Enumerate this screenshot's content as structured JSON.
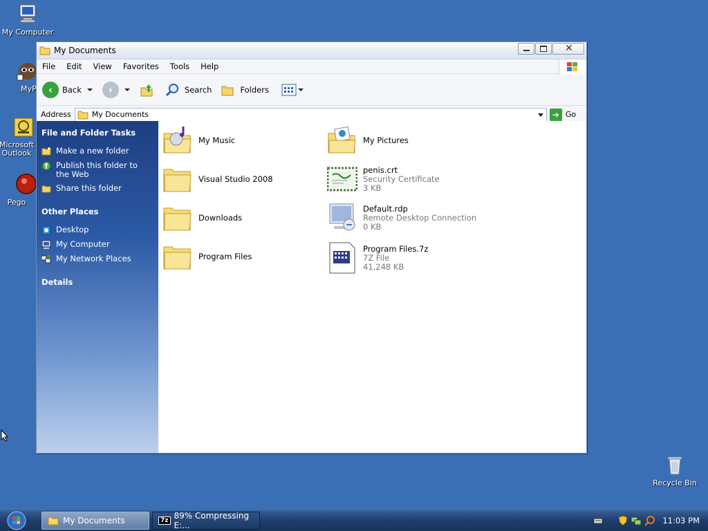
{
  "desktop": {
    "icons": [
      {
        "label": "My Computer"
      },
      {
        "label": "MyPal"
      },
      {
        "label": "Microsoft Outlook"
      },
      {
        "label": "Pego"
      },
      {
        "label": "Recycle Bin"
      }
    ]
  },
  "window": {
    "title": "My Documents",
    "menu": [
      "File",
      "Edit",
      "View",
      "Favorites",
      "Tools",
      "Help"
    ],
    "toolbar": {
      "back": "Back",
      "search": "Search",
      "folders": "Folders"
    },
    "address": {
      "label": "Address",
      "value": "My Documents",
      "go": "Go"
    },
    "taskpane": {
      "file_folder_tasks": {
        "title": "File and Folder Tasks",
        "items": [
          "Make a new folder",
          "Publish this folder to the Web",
          "Share this folder"
        ]
      },
      "other_places": {
        "title": "Other Places",
        "items": [
          "Desktop",
          "My Computer",
          "My Network Places"
        ]
      },
      "details": {
        "title": "Details"
      }
    },
    "files": [
      {
        "name": "My Music",
        "icon": "music-folder-icon"
      },
      {
        "name": "My Pictures",
        "icon": "pictures-folder-icon"
      },
      {
        "name": "Visual Studio 2008",
        "icon": "folder-icon"
      },
      {
        "name": "penis.crt",
        "type": "Security Certificate",
        "size": "3 KB",
        "icon": "certificate-icon"
      },
      {
        "name": "Downloads",
        "icon": "folder-icon"
      },
      {
        "name": "Default.rdp",
        "type": "Remote Desktop Connection",
        "size": "0 KB",
        "icon": "rdp-icon"
      },
      {
        "name": "Program Files",
        "icon": "folder-icon"
      },
      {
        "name": "Program Files.7z",
        "type": "7Z File",
        "size": "41,248 KB",
        "icon": "archive-icon"
      }
    ]
  },
  "taskbar": {
    "buttons": [
      {
        "label": "My Documents",
        "active": true
      },
      {
        "label": "89% Compressing E:...",
        "active": false
      }
    ],
    "clock": "11:03 PM"
  },
  "colors": {
    "desktop": "#3b6fb5",
    "taskpane_top": "#1e3f82",
    "taskbar": "#1d3d6e"
  }
}
